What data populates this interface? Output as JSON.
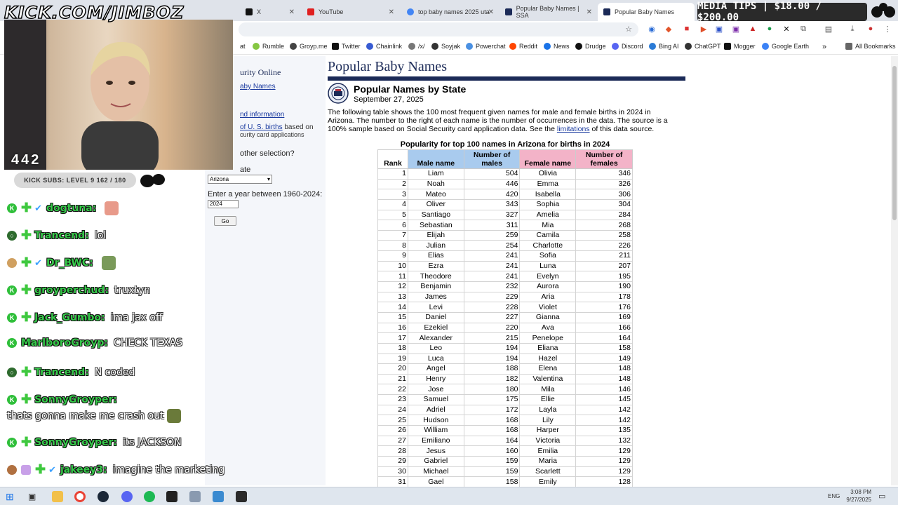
{
  "overlay": {
    "logo_text": "KICK.COM/JIMBOZ",
    "media_tips": "MEDIA TIPS | $18.00 / $200.00",
    "viewer_count": "442",
    "kick_subs": "KICK SUBS: LEVEL 9 162 / 180"
  },
  "tabs": [
    {
      "label": "X",
      "fav_color": "#111111"
    },
    {
      "label": "YouTube",
      "fav_color": "#e02020"
    },
    {
      "label": "top baby names 2025 uta",
      "fav_color": "#4285f4"
    },
    {
      "label": "Popular Baby Names | SSA",
      "fav_color": "#1b2a57"
    },
    {
      "label": "Popular Baby Names",
      "fav_color": "#1b2a57"
    }
  ],
  "bookmarks": [
    {
      "label": "at",
      "color": "#888888"
    },
    {
      "label": "Rumble",
      "color": "#85c742"
    },
    {
      "label": "Groyp.me",
      "color": "#444444"
    },
    {
      "label": "Twitter",
      "color": "#111111"
    },
    {
      "label": "Chainlink",
      "color": "#375bd2"
    },
    {
      "label": "/x/",
      "color": "#777777"
    },
    {
      "label": "Soyjak",
      "color": "#333333"
    },
    {
      "label": "Powerchat",
      "color": "#4a90e2"
    },
    {
      "label": "Reddit",
      "color": "#ff4500"
    },
    {
      "label": "News",
      "color": "#1a73e8"
    },
    {
      "label": "Drudge",
      "color": "#111111"
    },
    {
      "label": "Discord",
      "color": "#5865f2"
    },
    {
      "label": "Bing AI",
      "color": "#2b7bd6"
    },
    {
      "label": "ChatGPT",
      "color": "#333333"
    },
    {
      "label": "Mogger",
      "color": "#111111"
    },
    {
      "label": "Google Earth",
      "color": "#3b82f6"
    },
    {
      "label": "All Bookmarks",
      "color": "#666666"
    }
  ],
  "chat": [
    {
      "user": "dogtuna:",
      "text": "",
      "badge": "K",
      "badge_color": "#2fbf3a"
    },
    {
      "user": "Trancend:",
      "text": "lol",
      "badge": "",
      "badge_color": "#2e6b2e"
    },
    {
      "user": "Dr_BWC:",
      "text": "",
      "badge": "",
      "badge_color": "#d0a060"
    },
    {
      "user": "groyperchud:",
      "text": "truxtyn",
      "badge": "K",
      "badge_color": "#2fbf3a"
    },
    {
      "user": "Jack_Gumbo:",
      "text": "ima jax off",
      "badge": "K",
      "badge_color": "#2fbf3a"
    },
    {
      "user": "MarlboroGroyp:",
      "text": "CHECK TEXAS",
      "badge": "K",
      "badge_color": "#2fbf3a"
    },
    {
      "user": "Trancend:",
      "text": "N coded",
      "badge": "",
      "badge_color": "#2e6b2e"
    },
    {
      "user": "SonnyGroyper:",
      "text": "",
      "badge": "K",
      "badge_color": "#2fbf3a"
    },
    {
      "user": "SonnyGroyper:",
      "text": "its JACKSON",
      "badge": "K",
      "badge_color": "#2fbf3a"
    },
    {
      "user": "jakeey3:",
      "text": "imagine the marketing",
      "badge": "",
      "badge_color": "#b07040"
    }
  ],
  "chat_extra_line": "thats gonna make me crash out",
  "ssa": {
    "left_header": "urity Online",
    "link_baby_names": "aby Names",
    "link_background": "nd information",
    "link_births": "of U. S. births",
    "births_note_1": " based on",
    "births_note_2": "curity card applications",
    "other_selection": "other selection?",
    "state_label": "ate",
    "state_value": "Arizona",
    "year_label": "Enter a year between 1960-2024:",
    "year_value": "2024",
    "go_label": "Go",
    "page_title": "Popular Baby Names",
    "heading": "Popular Names by State",
    "date": "September 27, 2025",
    "desc_1": "The following table shows the 100 most frequent given names for male and female births in 2024 in Arizona. The number to the right of each name is the number of occurrences in the data. The source is a 100% sample based on Social Security card application data. See the ",
    "desc_link": "limitations",
    "desc_2": " of this data source.",
    "table_caption": "Popularity for top 100 names in Arizona for births in 2024",
    "headers": {
      "rank": "Rank",
      "male_name": "Male name",
      "male_num": "Number of males",
      "female_name": "Female name",
      "female_num": "Number of females"
    },
    "rows": [
      [
        "1",
        "Liam",
        "504",
        "Olivia",
        "346"
      ],
      [
        "2",
        "Noah",
        "446",
        "Emma",
        "326"
      ],
      [
        "3",
        "Mateo",
        "420",
        "Isabella",
        "306"
      ],
      [
        "4",
        "Oliver",
        "343",
        "Sophia",
        "304"
      ],
      [
        "5",
        "Santiago",
        "327",
        "Amelia",
        "284"
      ],
      [
        "6",
        "Sebastian",
        "311",
        "Mia",
        "268"
      ],
      [
        "7",
        "Elijah",
        "259",
        "Camila",
        "258"
      ],
      [
        "8",
        "Julian",
        "254",
        "Charlotte",
        "226"
      ],
      [
        "9",
        "Elias",
        "241",
        "Sofia",
        "211"
      ],
      [
        "10",
        "Ezra",
        "241",
        "Luna",
        "207"
      ],
      [
        "11",
        "Theodore",
        "241",
        "Evelyn",
        "195"
      ],
      [
        "12",
        "Benjamin",
        "232",
        "Aurora",
        "190"
      ],
      [
        "13",
        "James",
        "229",
        "Aria",
        "178"
      ],
      [
        "14",
        "Levi",
        "228",
        "Violet",
        "176"
      ],
      [
        "15",
        "Daniel",
        "227",
        "Gianna",
        "169"
      ],
      [
        "16",
        "Ezekiel",
        "220",
        "Ava",
        "166"
      ],
      [
        "17",
        "Alexander",
        "215",
        "Penelope",
        "164"
      ],
      [
        "18",
        "Leo",
        "194",
        "Eliana",
        "158"
      ],
      [
        "19",
        "Luca",
        "194",
        "Hazel",
        "149"
      ],
      [
        "20",
        "Angel",
        "188",
        "Elena",
        "148"
      ],
      [
        "21",
        "Henry",
        "182",
        "Valentina",
        "148"
      ],
      [
        "22",
        "Jose",
        "180",
        "Mila",
        "146"
      ],
      [
        "23",
        "Samuel",
        "175",
        "Ellie",
        "145"
      ],
      [
        "24",
        "Adriel",
        "172",
        "Layla",
        "142"
      ],
      [
        "25",
        "Hudson",
        "168",
        "Lily",
        "142"
      ],
      [
        "26",
        "William",
        "168",
        "Harper",
        "135"
      ],
      [
        "27",
        "Emiliano",
        "164",
        "Victoria",
        "132"
      ],
      [
        "28",
        "Jesus",
        "160",
        "Emilia",
        "129"
      ],
      [
        "29",
        "Gabriel",
        "159",
        "Maria",
        "129"
      ],
      [
        "30",
        "Michael",
        "159",
        "Scarlett",
        "129"
      ],
      [
        "31",
        "Gael",
        "158",
        "Emily",
        "128"
      ]
    ]
  },
  "taskbar": {
    "lang": "ENG",
    "time": "3:08 PM",
    "date": "9/27/2025"
  }
}
